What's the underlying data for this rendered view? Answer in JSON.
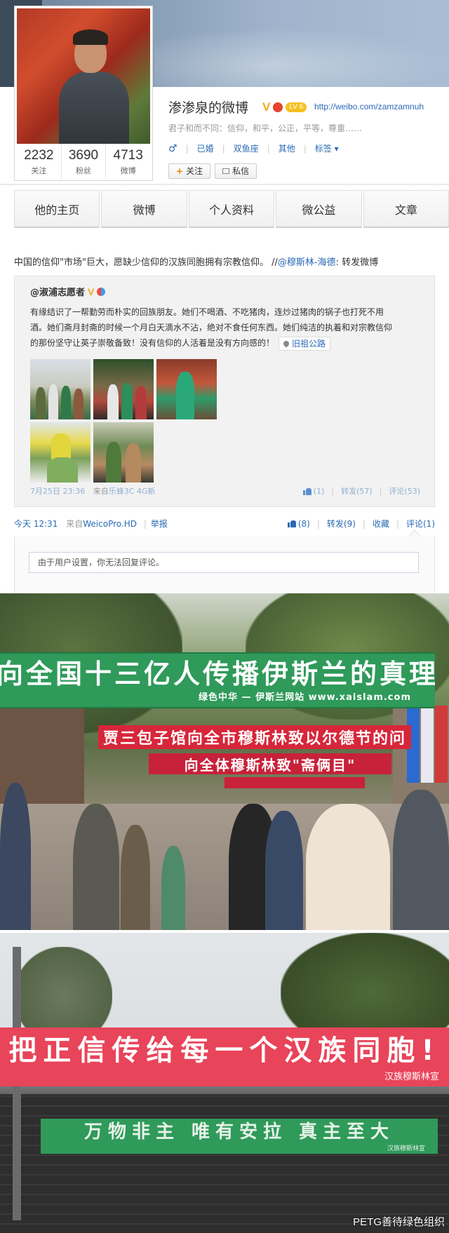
{
  "profile": {
    "name": "渗渗泉的微博",
    "verified_badge": "V",
    "level_badge": "LV 6",
    "homepage_url": "http://weibo.com/zamzamnuh",
    "bio": "君子和而不同：信仰，和平，公正，平等，尊重……",
    "gender_icon": "♂",
    "tags": [
      "已婚",
      "双鱼座",
      "其他"
    ],
    "tags_dropdown": "标签 ▾",
    "follow_button": "关注",
    "message_button": "私信",
    "stats": [
      {
        "num": "2232",
        "label": "关注"
      },
      {
        "num": "3690",
        "label": "粉丝"
      },
      {
        "num": "4713",
        "label": "微博"
      }
    ]
  },
  "tabs": [
    "他的主页",
    "微博",
    "个人资料",
    "微公益",
    "文章"
  ],
  "post": {
    "text": "中国的信仰\"市场\"巨大，愿缺少信仰的汉族同胞拥有宗教信仰。 //",
    "rt_user": "@穆斯林-海德",
    "rt_suffix": ": 转发微博",
    "retweet": {
      "author": "@淑浦志愿者",
      "author_badge": "V",
      "body_lines": [
        "有缘结识了一帮勤劳而朴实的回族朋友。她们不喝酒、不吃猪肉，连炒过猪肉的锅子也打死不用",
        "酒。她们斋月封斋的时候一个月白天滴水不沾，绝对不食任何东西。她们纯洁的执着和对宗教信仰",
        "的那份坚守让英子崇敬备致！没有信仰的人活着是没有方向感的！"
      ],
      "location": "旧祖公路",
      "time": "7月25日 23:36",
      "source_prefix": "来自",
      "source": "乐蜂3C 4G新",
      "likes": "(1)",
      "reposts": "转发(57)",
      "comments": "评论(53)"
    },
    "time": "今天 12:31",
    "source_prefix": "来自",
    "source": "WeicoPro.HD",
    "report": "举报",
    "likes": "(8)",
    "reposts": "转发(9)",
    "favorite": "收藏",
    "comments": "评论(1)",
    "comment_notice": "由于用户设置，你无法回复评论。"
  },
  "photos": {
    "street_banner_main": "向全国十三亿人传播伊斯兰的真理",
    "street_banner_sub": "绿色中华 — 伊斯兰网站 www.xaislam.com",
    "street_banner_red_1": "贾三包子馆向全市穆斯林致以尔德节的问",
    "street_banner_red_2": "向全体穆斯林致\"斋俩目\"",
    "wall_banner_main": "把正信传给每一个汉族同胞!",
    "wall_banner_sub": "汉族穆斯林宣",
    "wall_green_main": "万物非主 唯有安拉 真主至大",
    "wall_green_sub": "汉族穆斯林宣",
    "watermark": "PETG善待绿色组织"
  },
  "colors": {
    "link": "#2a6ab5",
    "accent_orange": "#f08300",
    "banner_green": "#2f9a5a",
    "banner_red": "#d7263a"
  }
}
